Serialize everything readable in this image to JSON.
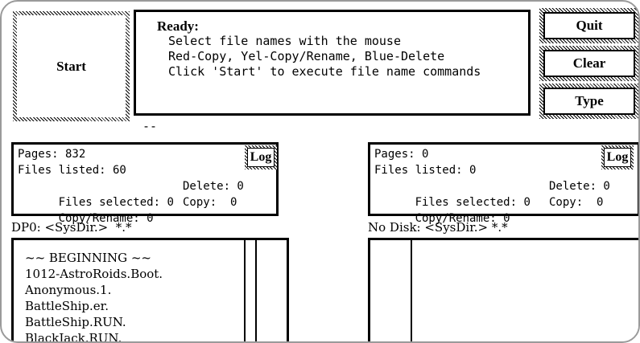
{
  "start_button": {
    "label": "Start"
  },
  "message": {
    "title": "Ready:",
    "lines": [
      "Select file names with the mouse",
      "Red-Copy, Yel-Copy/Rename, Blue-Delete",
      "Click 'Start' to execute file name commands"
    ]
  },
  "side_buttons": {
    "quit": "Quit",
    "clear": "Clear",
    "type": "Type"
  },
  "status_dashes": "--",
  "left_stats": {
    "pages": "Pages: 832",
    "files_listed": "Files listed: 60",
    "files_selected": "Files selected: 0",
    "delete": "Delete: 0",
    "copy_rename": "Copy/Rename: 0",
    "copy": "Copy:  0",
    "log_label": "Log"
  },
  "right_stats": {
    "pages": "Pages: 0",
    "files_listed": "Files listed: 0",
    "files_selected": "Files selected: 0",
    "delete": "Delete: 0",
    "copy_rename": "Copy/Rename: 0",
    "copy": "Copy:  0",
    "log_label": "Log"
  },
  "left_directory": {
    "label": "DP0: <SysDir.>  *.*",
    "files": [
      "~~ BEGINNING ~~",
      "1012-AstroRoids.Boot.",
      "Anonymous.1.",
      "BattleShip.er.",
      "BattleShip.RUN.",
      "BlackJack.RUN."
    ]
  },
  "right_directory": {
    "label": "No Disk: <SysDir.> *.*"
  }
}
